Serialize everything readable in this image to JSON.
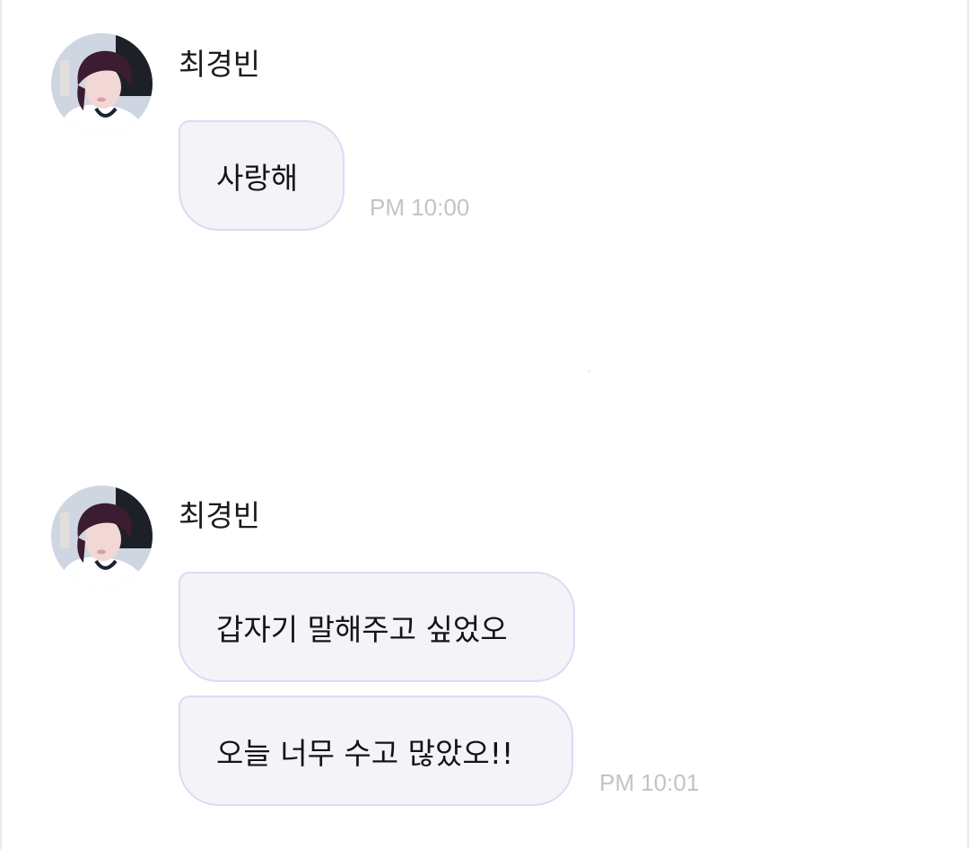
{
  "messages": [
    {
      "sender": "최경빈",
      "avatar": "profile-photo",
      "bubbles": [
        "사랑해"
      ],
      "time": "PM 10:00"
    },
    {
      "sender": "최경빈",
      "avatar": "profile-photo",
      "bubbles": [
        "갑자기 말해주고 싶었오",
        "오늘 너무 수고 많았오!!"
      ],
      "time": "PM 10:01"
    }
  ],
  "colors": {
    "bubble_background": "#f3f3f8",
    "bubble_border": "#e0d8f6",
    "timestamp": "#c3c3c8",
    "text": "#141418"
  }
}
